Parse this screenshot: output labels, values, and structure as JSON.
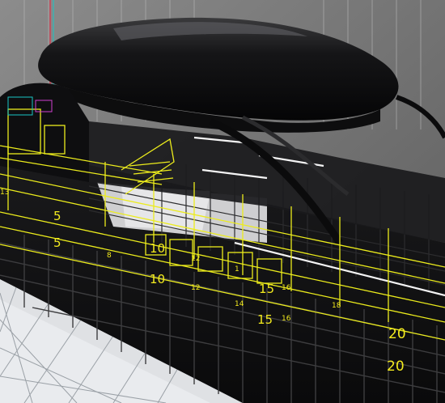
{
  "viewport": {
    "kind": "3d-cad-perspective",
    "subject": "yacht superstructure wireframe with station grid",
    "background_color": "#6e6e6e",
    "ground_grid_color": "#e9ebee",
    "wireframe_color": "#ecec1c",
    "axis_colors": {
      "x": "#e0304a",
      "y": "#18c6c6"
    }
  },
  "frame_labels": [
    {
      "text": "5"
    },
    {
      "text": "5"
    },
    {
      "text": "10"
    },
    {
      "text": "10"
    },
    {
      "text": "15"
    },
    {
      "text": "15"
    },
    {
      "text": "20"
    },
    {
      "text": "20"
    },
    {
      "text": "12"
    },
    {
      "text": "12"
    },
    {
      "text": "16"
    },
    {
      "text": "16"
    },
    {
      "text": "18"
    },
    {
      "text": "14"
    },
    {
      "text": "13"
    },
    {
      "text": "8"
    },
    {
      "text": "1"
    }
  ]
}
